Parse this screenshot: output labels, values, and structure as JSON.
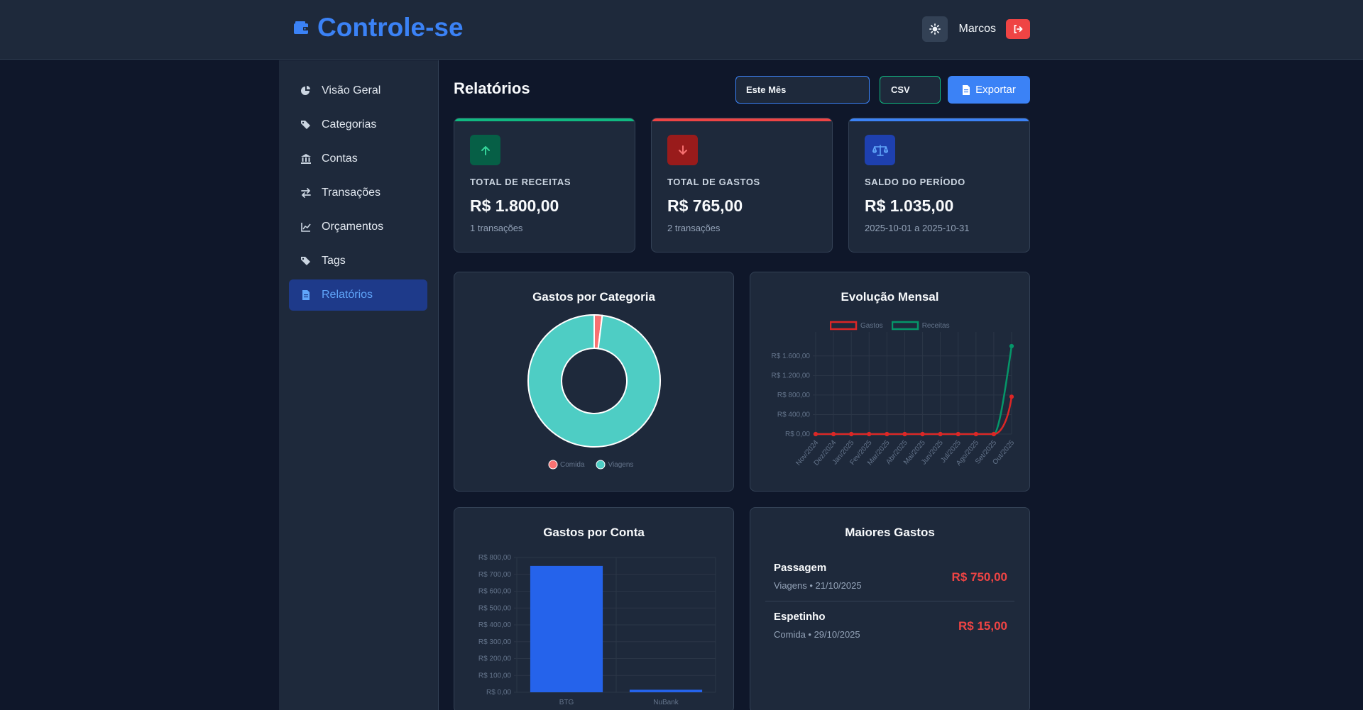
{
  "app": {
    "title": "Controle-se"
  },
  "header": {
    "user_name": "Marcos"
  },
  "sidebar": {
    "items": [
      {
        "label": "Visão Geral",
        "icon": "pie-chart-icon"
      },
      {
        "label": "Categorias",
        "icon": "tags-icon"
      },
      {
        "label": "Contas",
        "icon": "bank-icon"
      },
      {
        "label": "Transações",
        "icon": "exchange-icon"
      },
      {
        "label": "Orçamentos",
        "icon": "line-chart-icon"
      },
      {
        "label": "Tags",
        "icon": "tags-icon"
      },
      {
        "label": "Relatórios",
        "icon": "file-icon",
        "active": true
      }
    ]
  },
  "page": {
    "title": "Relatórios",
    "period_value": "Este Mês",
    "format_value": "CSV",
    "export_label": "Exportar"
  },
  "summary": {
    "income": {
      "label": "TOTAL DE RECEITAS",
      "value": "R$ 1.800,00",
      "sub": "1 transações",
      "color": "#10b981"
    },
    "expense": {
      "label": "TOTAL DE GASTOS",
      "value": "R$ 765,00",
      "sub": "2 transações",
      "color": "#ef4444"
    },
    "balance": {
      "label": "SALDO DO PERÍODO",
      "value": "R$ 1.035,00",
      "sub": "2025-10-01 a 2025-10-31",
      "color": "#3b82f6"
    }
  },
  "chart_data": [
    {
      "type": "pie",
      "title": "Gastos por Categoria",
      "categories": [
        "Comida",
        "Viagens"
      ],
      "values": [
        15,
        750
      ],
      "colors": [
        "#f87171",
        "#4ecdc4"
      ],
      "legend": "bottom"
    },
    {
      "type": "line",
      "title": "Evolução Mensal",
      "x": [
        "Nov/2024",
        "Dez/2024",
        "Jan/2025",
        "Fev/2025",
        "Mar/2025",
        "Abr/2025",
        "Mai/2025",
        "Jun/2025",
        "Jul/2025",
        "Ago/2025",
        "Set/2025",
        "Out/2025"
      ],
      "series": [
        {
          "name": "Gastos",
          "color": "#dc2626",
          "values": [
            0,
            0,
            0,
            0,
            0,
            0,
            0,
            0,
            0,
            0,
            0,
            765
          ]
        },
        {
          "name": "Receitas",
          "color": "#059669",
          "values": [
            0,
            0,
            0,
            0,
            0,
            0,
            0,
            0,
            0,
            0,
            0,
            1800
          ]
        }
      ],
      "yticks": [
        "R$ 0,00",
        "R$ 400,00",
        "R$ 800,00",
        "R$ 1.200,00",
        "R$ 1.600,00"
      ],
      "ylim": [
        0,
        1800
      ],
      "legend": "top",
      "grid": true
    },
    {
      "type": "bar",
      "title": "Gastos por Conta",
      "categories": [
        "BTG",
        "NuBank"
      ],
      "values": [
        750,
        15
      ],
      "color": "#2563eb",
      "yticks": [
        "R$ 0,00",
        "R$ 100,00",
        "R$ 200,00",
        "R$ 300,00",
        "R$ 400,00",
        "R$ 500,00",
        "R$ 600,00",
        "R$ 700,00",
        "R$ 800,00"
      ],
      "ylim": [
        0,
        800
      ],
      "grid": true
    }
  ],
  "top_expenses": {
    "title": "Maiores Gastos",
    "items": [
      {
        "name": "Passagem",
        "meta": "Viagens • 21/10/2025",
        "amount": "R$ 750,00"
      },
      {
        "name": "Espetinho",
        "meta": "Comida • 29/10/2025",
        "amount": "R$ 15,00"
      }
    ]
  }
}
